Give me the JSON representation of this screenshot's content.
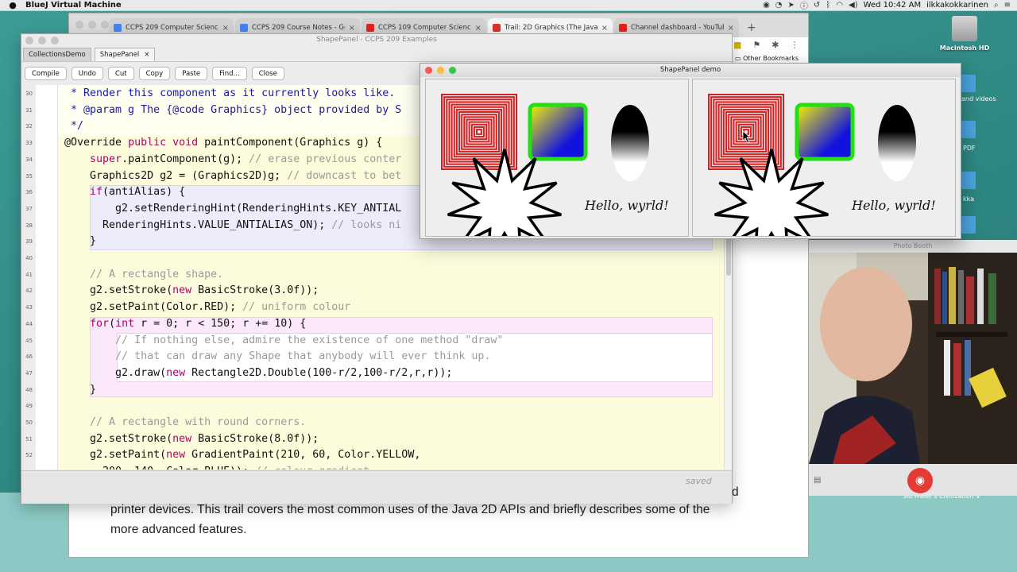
{
  "menubar": {
    "app_name": "BlueJ Virtual Machine",
    "clock": "Wed 10:42 AM",
    "user": "ilkkakokkarinen"
  },
  "browser": {
    "tabs": [
      {
        "label": "CCPS 209 Computer Science I",
        "color": "#4285f4"
      },
      {
        "label": "CCPS 209 Course Notes - Goo",
        "color": "#4285f4"
      },
      {
        "label": "CCPS 109 Computer Science I",
        "color": "#e62117"
      },
      {
        "label": "Trail: 2D Graphics (The Java™",
        "color": "#d9342b"
      },
      {
        "label": "Channel dashboard - YouTube",
        "color": "#e62117"
      }
    ],
    "new_tab": "+",
    "bookmarks_label": "Other Bookmarks",
    "page_text_line1": "printer devices. This trail covers the most common uses of the Java 2D APIs and briefly describes some of the",
    "page_text_line2": "more advanced features.",
    "page_text_fragment": "d"
  },
  "bluej": {
    "window_title": "ShapePanel - CCPS 209 Examples",
    "tabs": [
      "CollectionsDemo",
      "ShapePanel"
    ],
    "tab_close": "×",
    "toolbar": [
      "Compile",
      "Undo",
      "Cut",
      "Copy",
      "Paste",
      "Find...",
      "Close"
    ],
    "status": "saved",
    "lines": [
      {
        "n": "30",
        "html": "<span class='jd'> * Render this component as it currently looks like.</span>"
      },
      {
        "n": "31",
        "html": "<span class='jd'> * @param g The {@code Graphics} object provided by S</span>"
      },
      {
        "n": "32",
        "html": "<span class='jd'> */</span>"
      },
      {
        "n": "33",
        "html": "@Override <span class='kw'>public void</span> paintComponent(Graphics g) {"
      },
      {
        "n": "34",
        "html": "    <span class='kw'>super</span>.paintComponent(g); <span class='cm'>// erase previous conter</span>"
      },
      {
        "n": "35",
        "html": "    Graphics2D g2 = (Graphics2D)g; <span class='cm'>// downcast to bet</span>"
      },
      {
        "n": "36",
        "html": "    <span class='kw'>if</span>(antiAlias) {"
      },
      {
        "n": "37",
        "html": "        g2.setRenderingHint(RenderingHints.KEY_ANTIAL"
      },
      {
        "n": "38",
        "html": "      RenderingHints.VALUE_ANTIALIAS_ON); <span class='cm'>// looks ni</span>"
      },
      {
        "n": "39",
        "html": "    }"
      },
      {
        "n": "40",
        "html": ""
      },
      {
        "n": "41",
        "html": "    <span class='cm'>// A rectangle shape.</span>"
      },
      {
        "n": "42",
        "html": "    g2.setStroke(<span class='kw'>new</span> BasicStroke(3.0f));"
      },
      {
        "n": "43",
        "html": "    g2.setPaint(Color.RED); <span class='cm'>// uniform colour</span>"
      },
      {
        "n": "44",
        "html": "    <span class='kw'>for</span>(<span class='kw'>int</span> r = 0; r &lt; 150; r += 10) {"
      },
      {
        "n": "45",
        "html": "        <span class='cm'>// If nothing else, admire the existence of one method \"draw\"</span>"
      },
      {
        "n": "46",
        "html": "        <span class='cm'>// that can draw any Shape that anybody will ever think up.</span>"
      },
      {
        "n": "47",
        "html": "        g2.draw(<span class='kw'>new</span> Rectangle2D.Double(100-r/2,100-r/2,r,r));"
      },
      {
        "n": "48",
        "html": "    }"
      },
      {
        "n": "49",
        "html": ""
      },
      {
        "n": "50",
        "html": "    <span class='cm'>// A rectangle with round corners.</span>"
      },
      {
        "n": "51",
        "html": "    g2.setStroke(<span class='kw'>new</span> BasicStroke(8.0f));"
      },
      {
        "n": "52",
        "html": "    g2.setPaint(<span class='kw'>new</span> GradientPaint(210, 60, Color.YELLOW,"
      },
      {
        "n": "53",
        "html": "      200, 140, Color.BLUE)); <span class='cm'>// colour gradient</span>"
      }
    ]
  },
  "demo": {
    "title": "ShapePanel demo",
    "hello_text": "Hello, wyrld!",
    "colors": {
      "red": "#d42020",
      "green": "#22e011",
      "yellow": "#f5f500",
      "blue": "#1212e0"
    }
  },
  "photobooth": {
    "title": "Photo Booth",
    "camera_icon": "camera-icon"
  },
  "desktop": {
    "hd_label": "Macintosh HD",
    "side_labels": [
      "and videos",
      "PDF",
      "kka",
      "Sid Meier's Civilization V"
    ]
  }
}
